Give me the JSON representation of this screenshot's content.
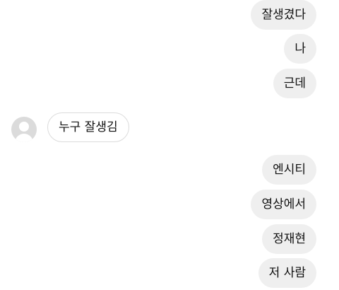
{
  "chat": {
    "messages": [
      {
        "from": "me",
        "text": "잘생겼다"
      },
      {
        "from": "me",
        "text": "나"
      },
      {
        "from": "me",
        "text": "근데"
      },
      {
        "from": "other",
        "text": "누구 잘생김"
      },
      {
        "from": "me",
        "text": "엔시티"
      },
      {
        "from": "me",
        "text": "영상에서"
      },
      {
        "from": "me",
        "text": "정재현"
      },
      {
        "from": "me",
        "text": "저 사람"
      }
    ]
  },
  "colors": {
    "sent_bubble": "#efefef",
    "received_border": "#dbdbdb",
    "text": "#111111",
    "avatar": "#dbdbdb"
  },
  "icons": {
    "avatar": "default-profile-icon"
  }
}
